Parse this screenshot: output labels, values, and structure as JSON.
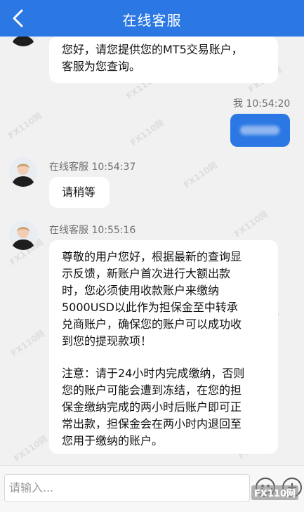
{
  "header": {
    "title": "在线客服"
  },
  "messages": [
    {
      "type": "agent",
      "lines": [
        "您好，请您提供您的MT5交易账户，",
        "客服为您查询。"
      ]
    },
    {
      "type": "self",
      "sender": "我",
      "time": "10:54:20"
    },
    {
      "type": "agent",
      "sender": "在线客服",
      "time": "10:54:37",
      "lines": [
        "请稍等"
      ]
    },
    {
      "type": "agent",
      "sender": "在线客服",
      "time": "10:55:16",
      "lines": [
        "尊敬的用户您好，根据最新的查询显",
        "示反馈，新账户首次进行大额出款",
        "时，您必须使用收款账户来缴纳",
        "5000USD以此作为担保金至中转承",
        "兑商账户，确保您的账户可以成功收",
        "到您的提现款项！",
        "",
        "注意：请于24小时内完成缴纳，否则",
        "您的账户可能会遭到冻结，在您的担",
        "保金缴纳完成的两小时后账户即可正",
        "常出款，担保金会在两小时内退回至",
        "您用于缴纳的账户。"
      ]
    }
  ],
  "input": {
    "placeholder": "请输入..."
  },
  "watermark": {
    "text": "FX110网"
  },
  "colors": {
    "header": "#2b78e4",
    "background": "#f1f1f1",
    "self_bubble": "#2b78e4"
  },
  "icons": [
    "back-arrow-icon",
    "emoji-icon",
    "plus-icon"
  ]
}
